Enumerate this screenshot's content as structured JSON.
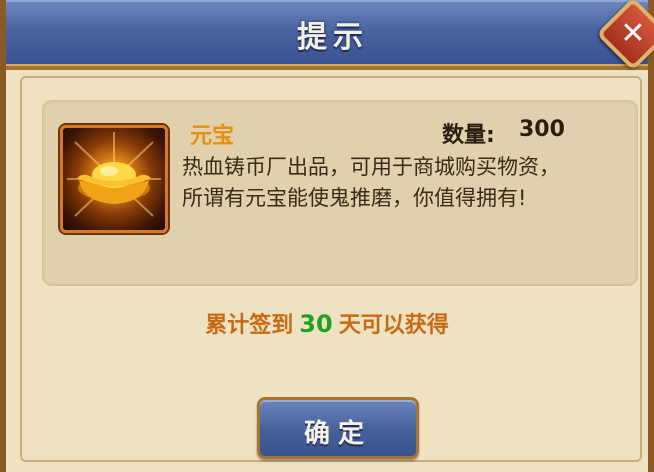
{
  "dialog": {
    "title": "提示",
    "close_icon": "close-icon",
    "close_symbol": "✕"
  },
  "item": {
    "icon": "gold-ingot-icon",
    "name": "元宝",
    "quantity_label": "数量:",
    "quantity_value": "300",
    "description_line1": "热血铸币厂出品，可用于商城购买物资，",
    "description_line2": "所谓有元宝能使鬼推磨，你值得拥有!"
  },
  "reward": {
    "prefix": "累计签到",
    "days": "30",
    "suffix": "天可以获得"
  },
  "actions": {
    "confirm_label": "确定"
  },
  "colors": {
    "header": "#4a64a0",
    "panel": "#efe2c3",
    "item_name": "#e8900e",
    "reward_text": "#c86a12",
    "reward_days": "#22a020"
  }
}
